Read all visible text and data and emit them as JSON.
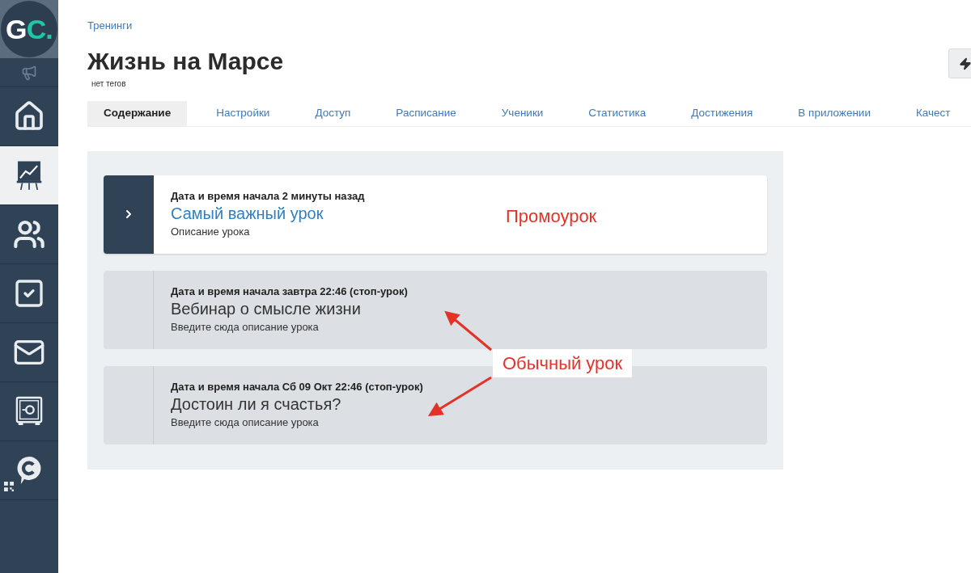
{
  "sidebar": {
    "logo": {
      "letters": "GC",
      "dot": "."
    },
    "items": [
      {
        "selected": false
      },
      {
        "selected": false
      },
      {
        "selected": true
      },
      {
        "selected": false
      },
      {
        "selected": false
      },
      {
        "selected": false
      },
      {
        "selected": false
      },
      {
        "selected": false
      }
    ]
  },
  "breadcrumb": "Тренинги",
  "title": "Жизнь на Марсе",
  "tags": "нет тегов",
  "tabs": [
    {
      "label": "Содержание",
      "selected": true
    },
    {
      "label": "Настройки",
      "selected": false
    },
    {
      "label": "Доступ",
      "selected": false
    },
    {
      "label": "Расписание",
      "selected": false
    },
    {
      "label": "Ученики",
      "selected": false
    },
    {
      "label": "Статистика",
      "selected": false
    },
    {
      "label": "Достижения",
      "selected": false
    },
    {
      "label": "В приложении",
      "selected": false
    },
    {
      "label": "Качест",
      "selected": false
    }
  ],
  "lessons": [
    {
      "kind": "promo",
      "start": "Дата и время начала 2 минуты назад",
      "title": "Самый важный урок",
      "description": "Описание урока"
    },
    {
      "kind": "regular",
      "start": "Дата и время начала завтра 22:46 (стоп-урок)",
      "title": "Вебинар о смысле жизни",
      "description": "Введите сюда описание урока"
    },
    {
      "kind": "regular",
      "start": "Дата и время начала Сб 09 Окт 22:46 (стоп-урок)",
      "title": "Достоин ли я счастья?",
      "description": "Введите сюда описание урока"
    }
  ],
  "annotations": {
    "promo": "Промоурок",
    "regular": "Обычный урок"
  }
}
